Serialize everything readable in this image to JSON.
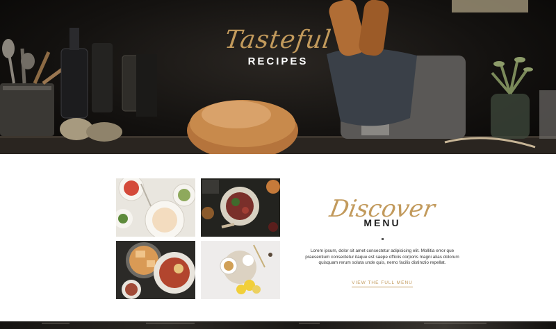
{
  "hero": {
    "script_title": "Tasteful",
    "subtitle": "RECIPES"
  },
  "discover": {
    "script_title": "Discover",
    "menu_label": "MENU",
    "body": "Lorem ipsum, dolor sit amet consectetur adipisicing elit. Mollitia error que praesentium consectetur itaque est saepe officiis corporis magni alias dolorum quisquam rerum soluta unde quis, nemo facilis distinctio repellat.",
    "link_label": "VIEW THE FULL MENU"
  },
  "gallery": {
    "items": [
      {
        "name": "dish-photo-salad-plates"
      },
      {
        "name": "dish-photo-meat-bowl"
      },
      {
        "name": "dish-photo-casserole-skillet"
      },
      {
        "name": "dish-photo-soup-lemons"
      }
    ]
  },
  "colors": {
    "accent_gold": "#c29a5c",
    "hero_dark": "#141210",
    "text_dark": "#222222"
  }
}
